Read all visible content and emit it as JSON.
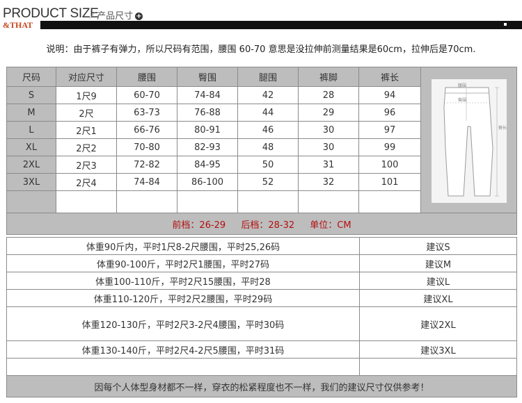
{
  "header": {
    "title": "PRODUCT SIZE",
    "subtitle": "产品尺寸",
    "brand": "&THAT"
  },
  "note": "说明：由于裤子有弹力，所以尺码有范围，腰围 60-70 意思是没拉伸前测量结果是60cm，拉伸后是70cm.",
  "size_table": {
    "headers": [
      "尺码",
      "对应尺寸",
      "腰围",
      "臀围",
      "腿围",
      "裤脚",
      "裤长"
    ],
    "rows": [
      [
        "S",
        "1尺9",
        "60-70",
        "74-84",
        "42",
        "28",
        "94"
      ],
      [
        "M",
        "2尺",
        "63-73",
        "76-88",
        "44",
        "29",
        "96"
      ],
      [
        "L",
        "2尺1",
        "66-76",
        "80-91",
        "46",
        "30",
        "97"
      ],
      [
        "XL",
        "2尺2",
        "70-80",
        "82-93",
        "48",
        "30",
        "99"
      ],
      [
        "2XL",
        "2尺3",
        "72-82",
        "84-95",
        "50",
        "31",
        "100"
      ],
      [
        "3XL",
        "2尺4",
        "74-84",
        "86-100",
        "52",
        "32",
        "101"
      ]
    ],
    "diagram_labels": {
      "waist": "腰围",
      "hip": "臀围",
      "length": "裤长"
    }
  },
  "measurements": {
    "front_rise": "前档：26-29",
    "back_rise": "后档：28-32",
    "unit": "单位：CM"
  },
  "recommendations": [
    {
      "desc": "体重90斤内，平时1尺8-2尺腰围，平时25,26码",
      "size": "建议S"
    },
    {
      "desc": "体重90-100斤，平时2尺1腰围，平时27码",
      "size": "建议M"
    },
    {
      "desc": "体重100-110斤，平时2尺15腰围，平时28",
      "size": "建议L"
    },
    {
      "desc": "体重110-120斤，平时2尺2腰围，平时29码",
      "size": "建议XL"
    },
    {
      "desc": "体重120-130斤，平时2尺3-2尺4腰围，平时30码",
      "size": "建议2XL"
    },
    {
      "desc": "体重130-140斤，平时2尺4-2尺5腰围，平时31码",
      "size": "建议3XL"
    }
  ],
  "footer": "因每个人体型身材都不一样，穿衣的松紧程度也不一样，我们的建议尺寸仅供参考！"
}
